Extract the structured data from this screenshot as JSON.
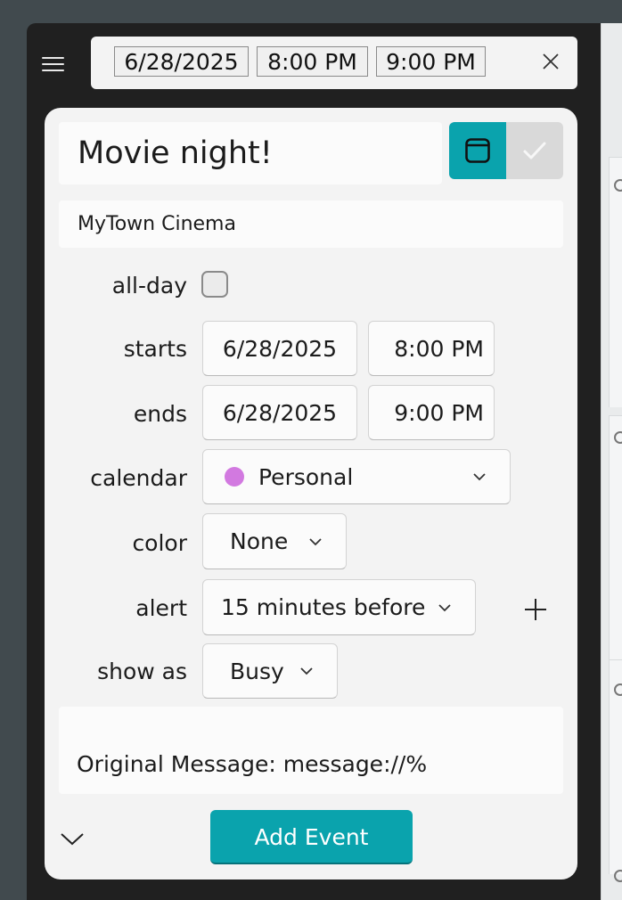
{
  "topbar": {
    "date": "6/28/2025",
    "start_time": "8:00 PM",
    "end_time": "9:00 PM"
  },
  "event": {
    "title": "Movie night!",
    "location": "MyTown Cinema",
    "notes": "Original Message: message://%"
  },
  "form": {
    "all_day_label": "all-day",
    "all_day_checked": false,
    "starts_label": "starts",
    "starts_date": "6/28/2025",
    "starts_time": "8:00 PM",
    "ends_label": "ends",
    "ends_date": "6/28/2025",
    "ends_time": "9:00 PM",
    "calendar_label": "calendar",
    "calendar_value": "Personal",
    "color_label": "color",
    "color_value": "None",
    "alert_label": "alert",
    "alert_value": "15 minutes before",
    "show_as_label": "show as",
    "show_as_value": "Busy"
  },
  "actions": {
    "add_event_label": "Add Event"
  },
  "colors": {
    "accent": "#0aa3ad",
    "personal_calendar": "#d279e0",
    "window_bg": "#202020",
    "card_bg": "#f3f3f3"
  },
  "icons": {
    "menu": "hamburger-menu-icon",
    "close": "close-icon",
    "event_mode": "calendar-window-icon",
    "task_mode": "checkmark-icon",
    "dropdown": "chevron-down-icon",
    "add_alert": "plus-icon",
    "expand": "chevron-down-icon"
  }
}
